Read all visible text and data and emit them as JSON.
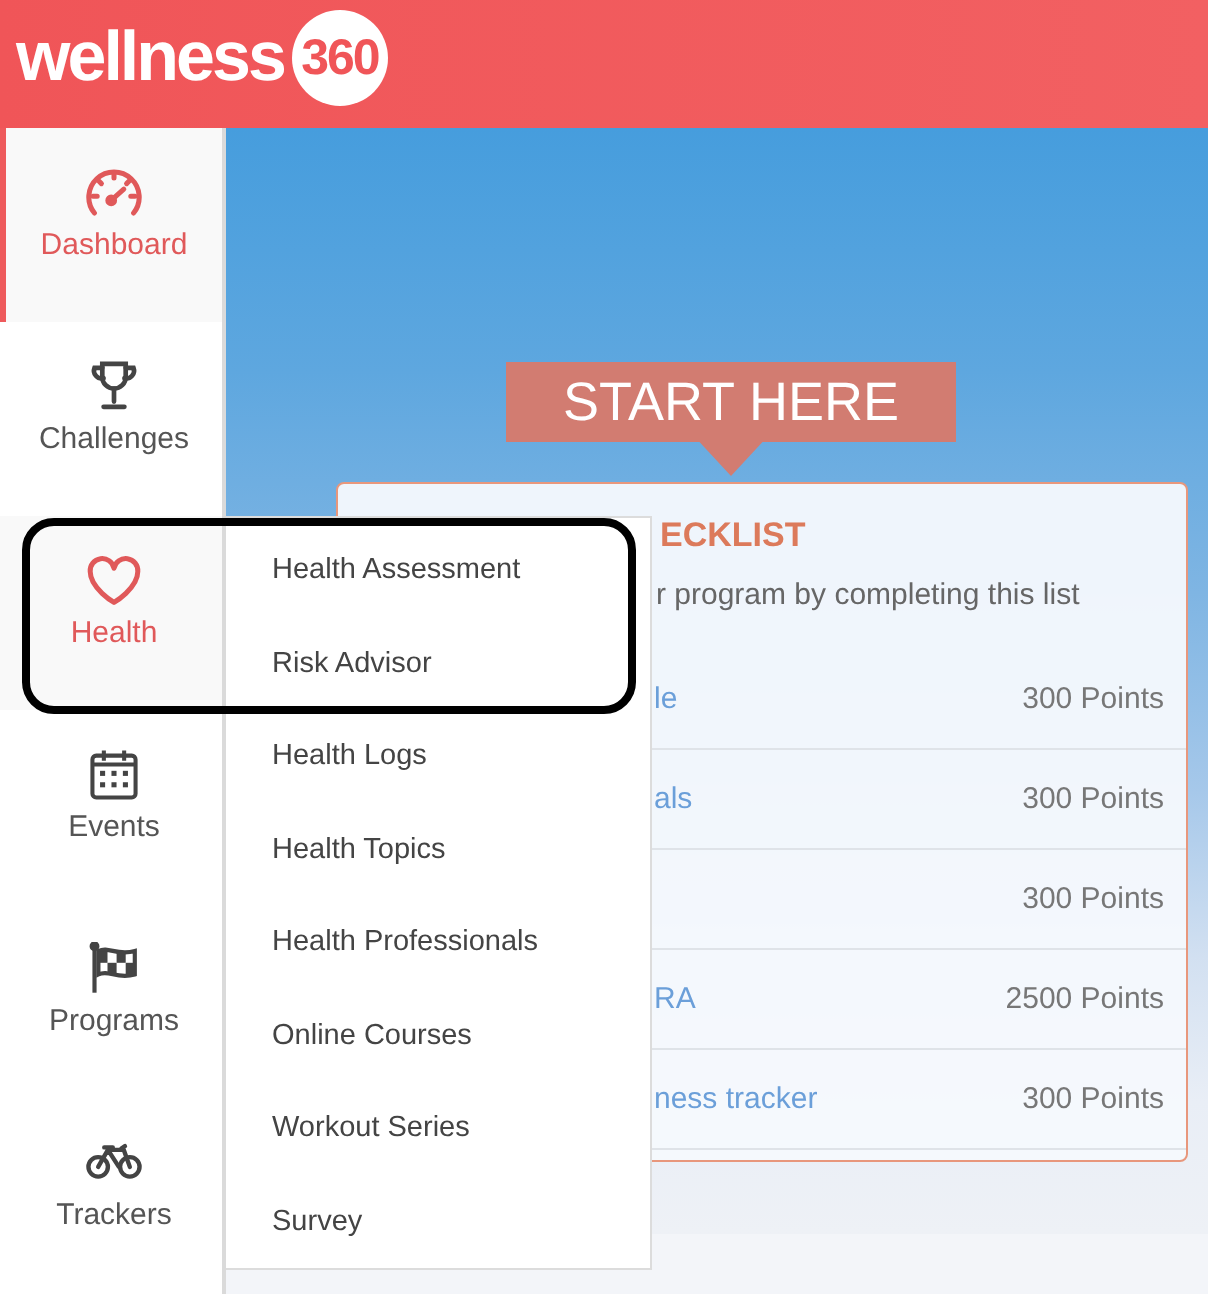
{
  "header": {
    "logo": {
      "wordmark": "wellness",
      "badge": "360"
    }
  },
  "sidebar": {
    "items": [
      {
        "label": "Dashboard",
        "selected": true,
        "expanded": false
      },
      {
        "label": "Challenges",
        "selected": false,
        "expanded": false
      },
      {
        "label": "Health",
        "selected": false,
        "expanded": true,
        "submenu": [
          "Health Assessment",
          "Risk Advisor",
          "Health Logs",
          "Health Topics",
          "Health Professionals",
          "Online Courses",
          "Workout Series",
          "Survey"
        ]
      },
      {
        "label": "Events",
        "selected": false,
        "expanded": false
      },
      {
        "label": "Programs",
        "selected": false,
        "expanded": false
      },
      {
        "label": "Trackers",
        "selected": false,
        "expanded": false
      }
    ]
  },
  "hero": {
    "banner": "START HERE",
    "checklist": {
      "title": "ECKLIST",
      "subtitle": "r program by completing this list",
      "rows": [
        {
          "task": "le",
          "points": "300 Points"
        },
        {
          "task": "als",
          "points": "300 Points"
        },
        {
          "points": "300 Points"
        },
        {
          "task": "RA",
          "points": "2500 Points"
        },
        {
          "task": "ness tracker",
          "points": "300 Points"
        }
      ]
    }
  }
}
